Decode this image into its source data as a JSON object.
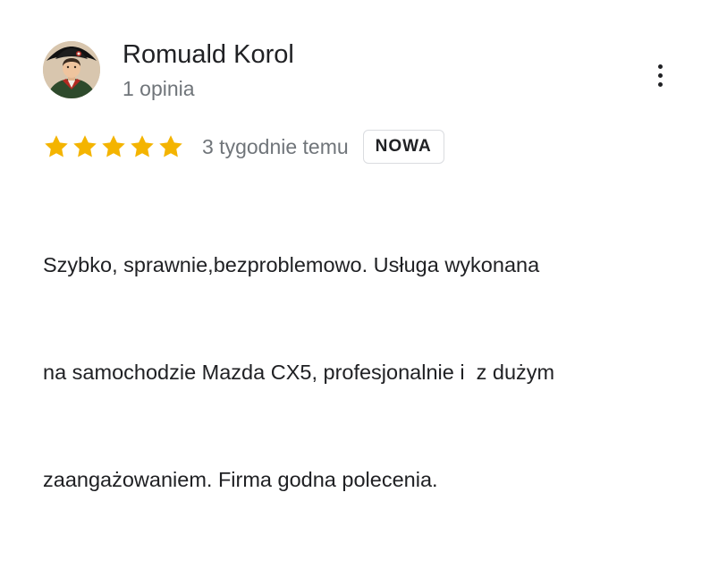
{
  "review": {
    "reviewer_name": "Romuald Korol",
    "review_count": "1 opinia",
    "rating": 5,
    "max_rating": 5,
    "timestamp": "3 tygodnie temu",
    "badge": "NOWA",
    "text_lines": [
      "Szybko, sprawnie,bezproblemowo. Usługa wykonana",
      "na samochodzie Mazda CX5, profesjonalnie i  z dużym",
      "zaangażowaniem. Firma godna polecenia."
    ],
    "avatar_icon": "user-avatar-icon",
    "menu_icon": "more-vertical-icon",
    "star_icon": "star-icon"
  },
  "colors": {
    "star": "#f4b400",
    "secondary_text": "#70757a",
    "primary_text": "#202124",
    "badge_border": "#dadce0"
  }
}
